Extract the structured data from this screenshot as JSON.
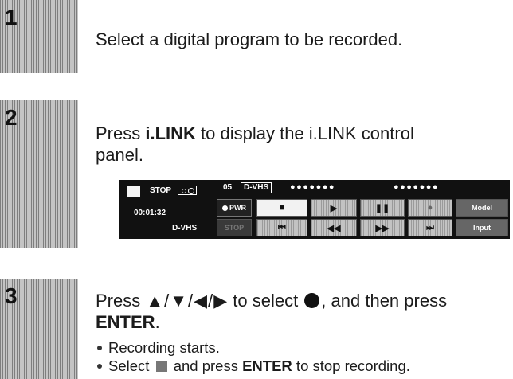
{
  "steps": [
    {
      "number": "1",
      "text": "Select a digital program to be recorded."
    },
    {
      "number": "2",
      "text_prefix": "Press ",
      "text_bold": "i.LINK",
      "text_suffix_line1": " to display the i.LINK control",
      "text_line2": "panel."
    },
    {
      "number": "3",
      "text_prefix": "Press ",
      "arrows": [
        "▲",
        "▼",
        "◀",
        "▶"
      ],
      "text_mid": " to select ",
      "text_suffix": ", and then press",
      "text_bold_line2": "ENTER",
      "text_line2_suffix": "."
    }
  ],
  "bullets": [
    {
      "text": "Recording starts."
    },
    {
      "prefix": "Select ",
      "mid": " and press ",
      "bold": "ENTER",
      "suffix": " to stop recording."
    }
  ],
  "panel": {
    "status": "STOP",
    "time": "00:01:32",
    "format": "D-VHS",
    "channel": "05",
    "format_tag": "D-VHS",
    "dots_group1": "●●●●●●●",
    "dots_group2": "●●●●●●●",
    "pwr_label": "PWR",
    "stop_label": "STOP",
    "model_label": "Model",
    "input_label": "Input",
    "icons": {
      "stop": "■",
      "play": "▶",
      "pause": "❚❚",
      "record": "●",
      "prev": "⏮",
      "rew": "◀◀",
      "ff": "▶▶",
      "next": "⏭"
    }
  }
}
